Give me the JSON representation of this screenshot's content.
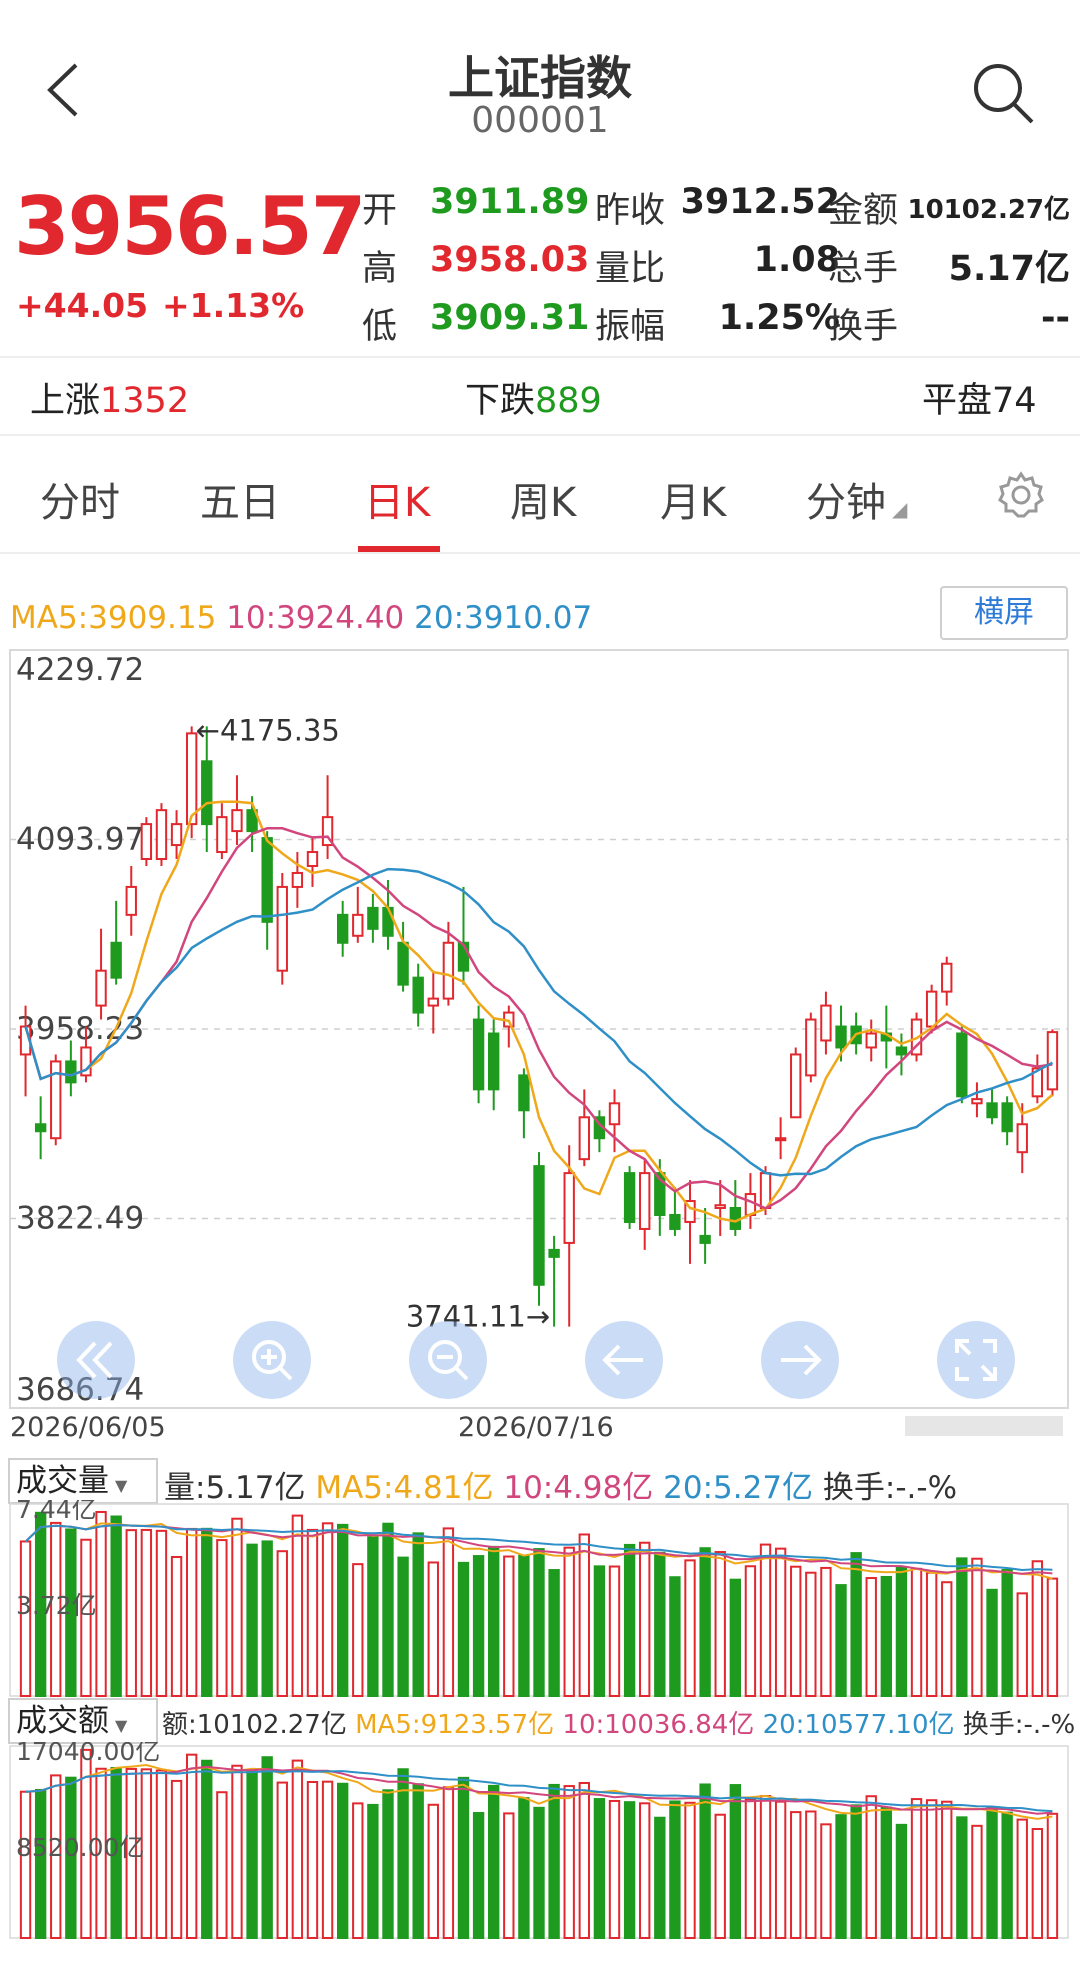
{
  "header": {
    "title": "上证指数",
    "code": "000001",
    "back_icon": "chevron-left-icon",
    "search_icon": "search-icon"
  },
  "quote": {
    "price": "3956.57",
    "change": "+44.05",
    "change_pct": "+1.13%",
    "fields": [
      {
        "label": "开",
        "value": "3911.89",
        "color": "green"
      },
      {
        "label": "昨收",
        "value": "3912.52",
        "color": "dark"
      },
      {
        "label": "金额",
        "value": "10102.27亿",
        "color": "dark"
      },
      {
        "label": "高",
        "value": "3958.03",
        "color": "red"
      },
      {
        "label": "量比",
        "value": "1.08",
        "color": "dark"
      },
      {
        "label": "总手",
        "value": "5.17亿",
        "color": "dark"
      },
      {
        "label": "低",
        "value": "3909.31",
        "color": "green"
      },
      {
        "label": "振幅",
        "value": "1.25%",
        "color": "dark"
      },
      {
        "label": "换手",
        "value": "--",
        "color": "dark"
      }
    ]
  },
  "breadth": {
    "up_label": "上涨",
    "up_value": "1352",
    "down_label": "下跌",
    "down_value": "889",
    "flat_label": "平盘",
    "flat_value": "74"
  },
  "tabs": [
    {
      "label": "分时",
      "active": false
    },
    {
      "label": "五日",
      "active": false
    },
    {
      "label": "日K",
      "active": true
    },
    {
      "label": "周K",
      "active": false
    },
    {
      "label": "月K",
      "active": false
    },
    {
      "label": "分钟",
      "active": false
    }
  ],
  "settings_icon": "gear-icon",
  "landscape_button": "横屏",
  "ma_legend": {
    "ma5": "MA5:3909.15",
    "ma10": "10:3924.40",
    "ma20": "20:3910.07"
  },
  "colors": {
    "up": "#e0282e",
    "down": "#1e9a1e",
    "ma5": "#f0a81b",
    "ma10": "#d2467e",
    "ma20": "#2f8fc7"
  },
  "nav_icons": [
    "double-left-icon",
    "zoom-in-icon",
    "zoom-out-icon",
    "arrow-left-icon",
    "arrow-right-icon",
    "fullscreen-icon"
  ],
  "chart_data": [
    {
      "type": "candlestick",
      "y_ticks": [
        "4229.72",
        "4093.97",
        "3958.23",
        "3822.49",
        "3686.74"
      ],
      "ylim": [
        3686.74,
        4229.72
      ],
      "x_labels": [
        "2026/06/05",
        "2026/07/16"
      ],
      "annotations": {
        "high": "4175.35",
        "low": "3741.11"
      },
      "grid": true,
      "candles": [
        [
          3940,
          3960,
          3910,
          3975
        ],
        [
          3890,
          3885,
          3865,
          3910
        ],
        [
          3880,
          3935,
          3875,
          3940
        ],
        [
          3935,
          3920,
          3910,
          3950
        ],
        [
          3925,
          3945,
          3920,
          3960
        ],
        [
          3975,
          4000,
          3965,
          4030
        ],
        [
          4020,
          3995,
          3990,
          4050
        ],
        [
          4040,
          4060,
          4025,
          4075
        ],
        [
          4080,
          4105,
          4075,
          4110
        ],
        [
          4080,
          4115,
          4075,
          4120
        ],
        [
          4090,
          4105,
          4080,
          4115
        ],
        [
          4105,
          4170,
          4095,
          4175
        ],
        [
          4150,
          4105,
          4085,
          4175
        ],
        [
          4085,
          4110,
          4080,
          4120
        ],
        [
          4100,
          4115,
          4090,
          4140
        ],
        [
          4115,
          4100,
          4085,
          4125
        ],
        [
          4095,
          4035,
          4015,
          4100
        ],
        [
          4000,
          4060,
          3990,
          4070
        ],
        [
          4060,
          4070,
          4045,
          4085
        ],
        [
          4075,
          4085,
          4060,
          4095
        ],
        [
          4090,
          4110,
          4080,
          4140
        ],
        [
          4040,
          4020,
          4010,
          4050
        ],
        [
          4025,
          4040,
          4020,
          4060
        ],
        [
          4045,
          4030,
          4020,
          4055
        ],
        [
          4045,
          4025,
          4015,
          4065
        ],
        [
          4020,
          3990,
          3985,
          4035
        ],
        [
          3995,
          3970,
          3960,
          4005
        ],
        [
          3975,
          3980,
          3955,
          4000
        ],
        [
          3980,
          4020,
          3975,
          4035
        ],
        [
          4020,
          4000,
          3990,
          4060
        ],
        [
          3965,
          3915,
          3905,
          3975
        ],
        [
          3955,
          3915,
          3900,
          3965
        ],
        [
          3960,
          3970,
          3945,
          3975
        ],
        [
          3925,
          3900,
          3880,
          3930
        ],
        [
          3860,
          3775,
          3760,
          3870
        ],
        [
          3800,
          3795,
          3745,
          3810
        ],
        [
          3805,
          3855,
          3745,
          3875
        ],
        [
          3865,
          3895,
          3860,
          3915
        ],
        [
          3895,
          3880,
          3870,
          3900
        ],
        [
          3890,
          3905,
          3870,
          3915
        ],
        [
          3855,
          3820,
          3815,
          3860
        ],
        [
          3815,
          3855,
          3800,
          3865
        ],
        [
          3855,
          3825,
          3810,
          3865
        ],
        [
          3825,
          3815,
          3810,
          3845
        ],
        [
          3820,
          3835,
          3790,
          3850
        ],
        [
          3810,
          3805,
          3790,
          3830
        ],
        [
          3830,
          3832,
          3810,
          3850
        ],
        [
          3830,
          3815,
          3810,
          3850
        ],
        [
          3825,
          3840,
          3815,
          3855
        ],
        [
          3830,
          3855,
          3825,
          3860
        ],
        [
          3880,
          3880,
          3865,
          3895
        ],
        [
          3895,
          3940,
          3895,
          3945
        ],
        [
          3925,
          3965,
          3920,
          3970
        ],
        [
          3950,
          3975,
          3940,
          3985
        ],
        [
          3960,
          3945,
          3935,
          3975
        ],
        [
          3960,
          3948,
          3940,
          3970
        ],
        [
          3945,
          3955,
          3935,
          3965
        ],
        [
          3955,
          3950,
          3930,
          3975
        ],
        [
          3945,
          3940,
          3925,
          3955
        ],
        [
          3940,
          3965,
          3935,
          3970
        ],
        [
          3960,
          3985,
          3955,
          3990
        ],
        [
          3985,
          4005,
          3975,
          4010
        ],
        [
          3955,
          3910,
          3905,
          3960
        ],
        [
          3905,
          3908,
          3895,
          3920
        ],
        [
          3905,
          3895,
          3890,
          3915
        ],
        [
          3905,
          3885,
          3875,
          3910
        ],
        [
          3870,
          3890,
          3855,
          3905
        ],
        [
          3910,
          3930,
          3905,
          3940
        ],
        [
          3915,
          3956,
          3910,
          3958
        ]
      ]
    },
    {
      "type": "bar",
      "title": "成交量",
      "legend": [
        "量:5.17亿",
        "MA5:4.81亿",
        "10:4.98亿",
        "20:5.27亿",
        "换手:-.-%"
      ],
      "y_ticks": [
        "7.44亿",
        "3.72亿"
      ],
      "ylim": [
        0,
        7.44
      ]
    },
    {
      "type": "bar",
      "title": "成交额",
      "legend": [
        "额:10102.27亿",
        "MA5:9123.57亿",
        "10:10036.84亿",
        "20:10577.10亿",
        "换手:-.-%"
      ],
      "y_ticks": [
        "17040.00亿",
        "8520.00亿"
      ],
      "ylim": [
        0,
        17040
      ]
    }
  ]
}
